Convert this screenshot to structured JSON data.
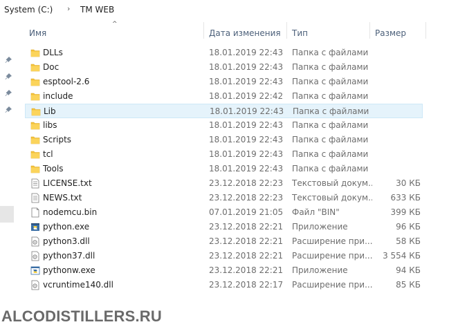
{
  "breadcrumb": {
    "drive": "System (C:)",
    "folder": "TM WEB"
  },
  "columns": {
    "name": "Имя",
    "date": "Дата изменения",
    "type": "Тип",
    "size": "Размер"
  },
  "files": [
    {
      "name": "DLLs",
      "date": "18.01.2019 22:43",
      "type": "Папка с файлами",
      "size": "",
      "icon": "folder-icon",
      "selected": false
    },
    {
      "name": "Doc",
      "date": "18.01.2019 22:43",
      "type": "Папка с файлами",
      "size": "",
      "icon": "folder-icon",
      "selected": false
    },
    {
      "name": "esptool-2.6",
      "date": "18.01.2019 22:43",
      "type": "Папка с файлами",
      "size": "",
      "icon": "folder-icon",
      "selected": false
    },
    {
      "name": "include",
      "date": "18.01.2019 22:42",
      "type": "Папка с файлами",
      "size": "",
      "icon": "folder-icon",
      "selected": false
    },
    {
      "name": "Lib",
      "date": "18.01.2019 22:43",
      "type": "Папка с файлами",
      "size": "",
      "icon": "folder-icon",
      "selected": true
    },
    {
      "name": "libs",
      "date": "18.01.2019 22:43",
      "type": "Папка с файлами",
      "size": "",
      "icon": "folder-icon",
      "selected": false
    },
    {
      "name": "Scripts",
      "date": "18.01.2019 22:43",
      "type": "Папка с файлами",
      "size": "",
      "icon": "folder-icon",
      "selected": false
    },
    {
      "name": "tcl",
      "date": "18.01.2019 22:43",
      "type": "Папка с файлами",
      "size": "",
      "icon": "folder-icon",
      "selected": false
    },
    {
      "name": "Tools",
      "date": "18.01.2019 22:43",
      "type": "Папка с файлами",
      "size": "",
      "icon": "folder-icon",
      "selected": false
    },
    {
      "name": "LICENSE.txt",
      "date": "23.12.2018 22:23",
      "type": "Текстовый докум...",
      "size": "30 КБ",
      "icon": "text-file-icon",
      "selected": false
    },
    {
      "name": "NEWS.txt",
      "date": "23.12.2018 22:23",
      "type": "Текстовый докум...",
      "size": "633 КБ",
      "icon": "text-file-icon",
      "selected": false
    },
    {
      "name": "nodemcu.bin",
      "date": "07.01.2019 21:05",
      "type": "Файл \"BIN\"",
      "size": "399 КБ",
      "icon": "blank-file-icon",
      "selected": false
    },
    {
      "name": "python.exe",
      "date": "23.12.2018 22:21",
      "type": "Приложение",
      "size": "96 КБ",
      "icon": "python-exe-icon",
      "selected": false
    },
    {
      "name": "python3.dll",
      "date": "23.12.2018 22:21",
      "type": "Расширение при...",
      "size": "58 КБ",
      "icon": "dll-file-icon",
      "selected": false
    },
    {
      "name": "python37.dll",
      "date": "23.12.2018 22:21",
      "type": "Расширение при...",
      "size": "3 554 КБ",
      "icon": "dll-file-icon",
      "selected": false
    },
    {
      "name": "pythonw.exe",
      "date": "23.12.2018 22:21",
      "type": "Приложение",
      "size": "94 КБ",
      "icon": "pythonw-exe-icon",
      "selected": false
    },
    {
      "name": "vcruntime140.dll",
      "date": "23.12.2018 22:17",
      "type": "Расширение при...",
      "size": "85 КБ",
      "icon": "dll-file-icon",
      "selected": false
    }
  ],
  "watermark": "ALCODISTILLERS.RU",
  "colors": {
    "folder": "#f5c33b",
    "selection_bg": "#e5f3fb",
    "header_text": "#4c607a"
  }
}
